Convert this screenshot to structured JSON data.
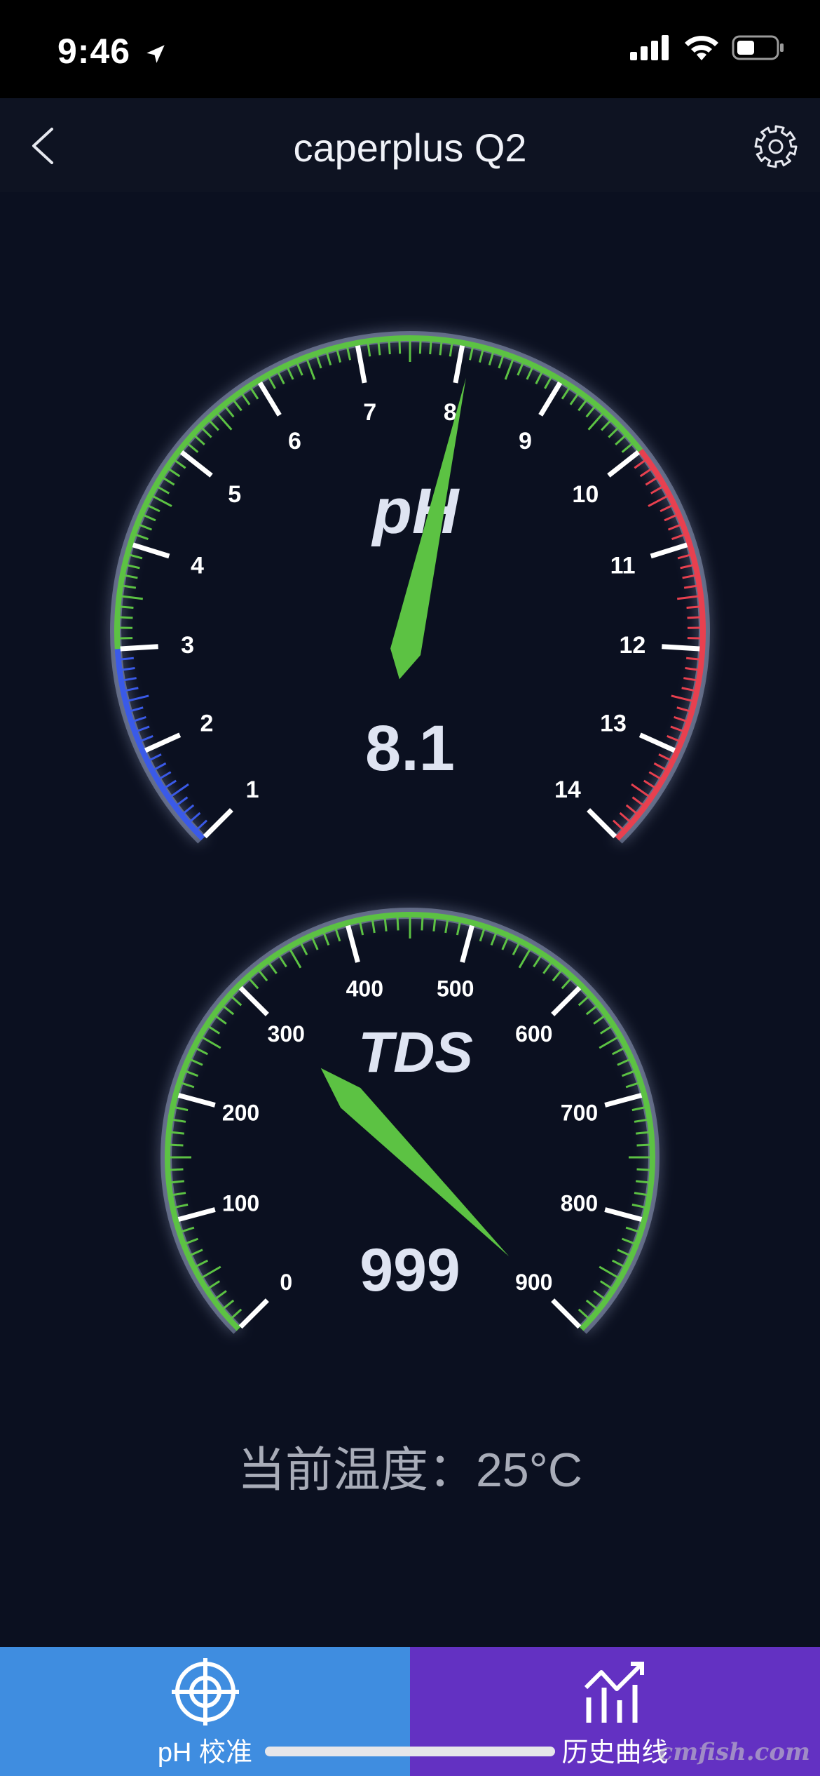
{
  "status": {
    "time": "9:46"
  },
  "nav": {
    "title": "caperplus Q2"
  },
  "ph_gauge": {
    "label": "pH",
    "value": 8.1,
    "value_text": "8.1",
    "min": 1,
    "max": 14,
    "ticks": [
      "1",
      "2",
      "3",
      "4",
      "5",
      "6",
      "7",
      "8",
      "9",
      "10",
      "11",
      "12",
      "13",
      "14"
    ],
    "zones": [
      {
        "from": 1,
        "to": 3,
        "color": "#3a5ae8"
      },
      {
        "from": 3,
        "to": 10,
        "color": "#5cc243"
      },
      {
        "from": 10,
        "to": 14,
        "color": "#e8404f"
      }
    ],
    "needle_color": "#5cc243"
  },
  "tds_gauge": {
    "label": "TDS",
    "value": 999,
    "value_text": "999",
    "min": 0,
    "max": 900,
    "ticks": [
      "0",
      "100",
      "200",
      "300",
      "400",
      "500",
      "600",
      "700",
      "800",
      "900"
    ],
    "zone_color": "#5cc243",
    "needle_color": "#5cc243"
  },
  "temperature": {
    "label": "当前温度：",
    "value": "25°C"
  },
  "tabs": {
    "calibration": "pH 校准",
    "history": "历史曲线"
  },
  "watermark": "cmfish.com",
  "colors": {
    "background": "#0b1020",
    "calib_tab": "#3f8de0",
    "history_tab": "#6331c2"
  }
}
